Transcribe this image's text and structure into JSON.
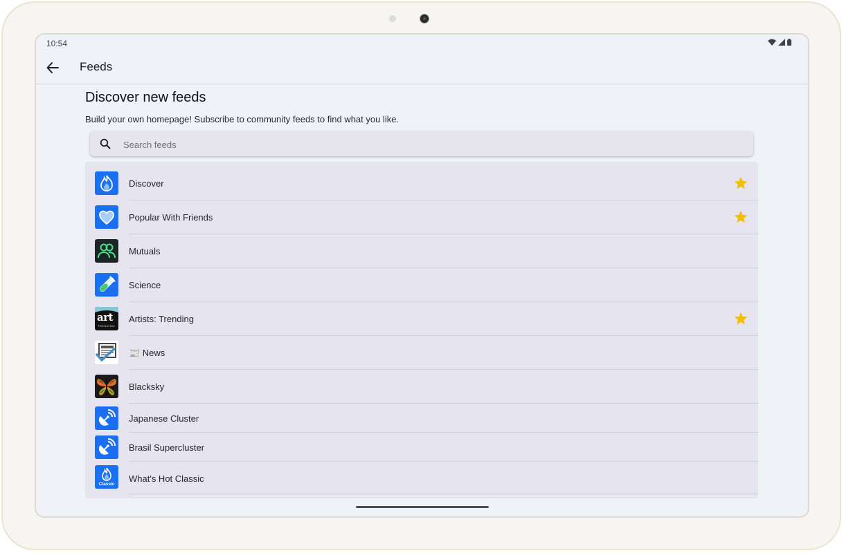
{
  "status_bar": {
    "time": "10:54"
  },
  "app_bar": {
    "title": "Feeds"
  },
  "page": {
    "heading": "Discover new feeds",
    "subtitle": "Build your own homepage! Subscribe to community feeds to find what you like."
  },
  "search": {
    "placeholder": "Search feeds",
    "value": ""
  },
  "feeds": [
    {
      "name": "Discover",
      "icon": "flame-icon",
      "starred": true
    },
    {
      "name": "Popular With Friends",
      "icon": "heart-icon",
      "starred": true
    },
    {
      "name": "Mutuals",
      "icon": "people-icon",
      "starred": false
    },
    {
      "name": "Science",
      "icon": "test-tube-icon",
      "starred": false
    },
    {
      "name": "Artists: Trending",
      "icon": "art-logo-icon",
      "starred": true
    },
    {
      "name": "📰 News",
      "icon": "newspaper-check-icon",
      "starred": false
    },
    {
      "name": "Blacksky",
      "icon": "butterfly-pattern-icon",
      "starred": false
    },
    {
      "name": "Japanese Cluster",
      "icon": "satellite-icon",
      "starred": false
    },
    {
      "name": "Brasil Supercluster",
      "icon": "satellite-icon",
      "starred": false
    },
    {
      "name": "What's Hot Classic",
      "icon": "flame-classic-icon",
      "starred": false,
      "icon_label": "Classic"
    }
  ],
  "colors": {
    "accent_blue": "#1a6ff2",
    "star": "#f5bd00",
    "screen_bg": "#eff2f7",
    "list_bg": "#e6e5ef"
  },
  "art_logo": {
    "big": "art",
    "small": "TRENDING"
  }
}
